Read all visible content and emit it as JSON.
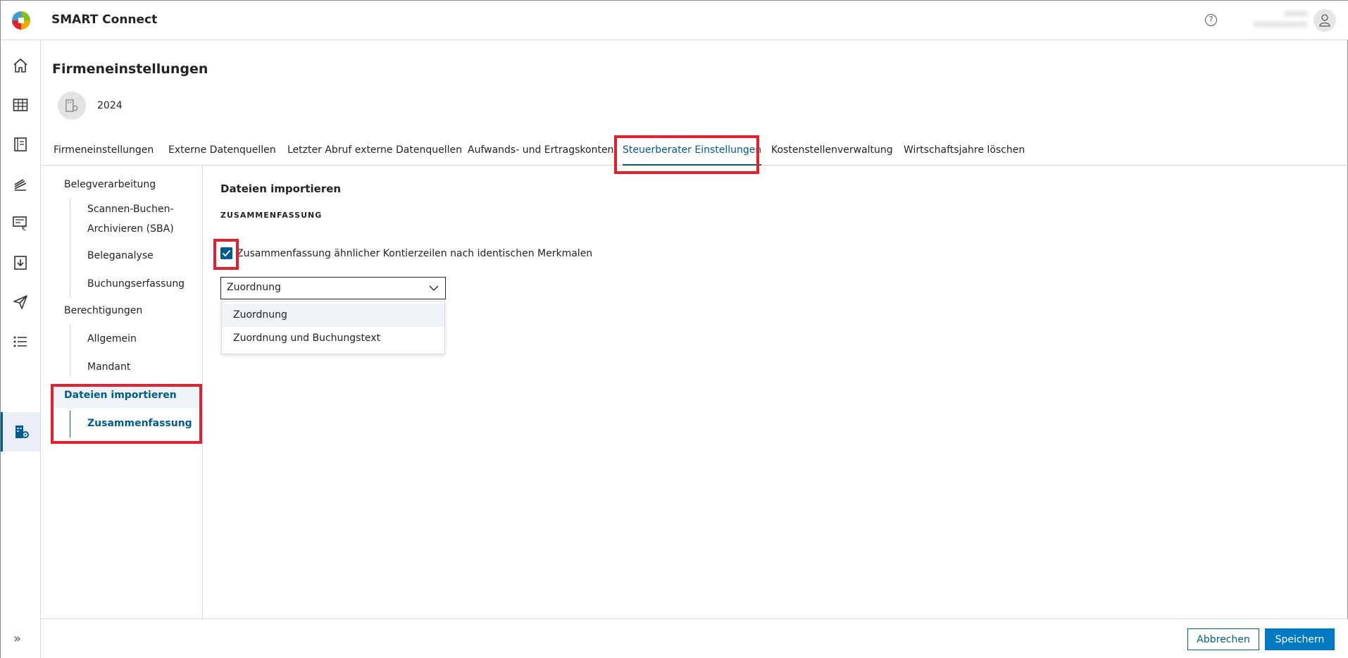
{
  "app": {
    "title": "SMART Connect"
  },
  "header": {
    "help_icon": "?"
  },
  "page": {
    "title": "Firmeneinstellungen",
    "company_year": "2024"
  },
  "tabs": [
    {
      "label": "Firmeneinstellungen"
    },
    {
      "label": "Externe Datenquellen"
    },
    {
      "label": "Letzter Abruf externe Datenquellen"
    },
    {
      "label": "Aufwands- und Ertragskonten"
    },
    {
      "label": "Steuerberater Einstellungen",
      "active": true
    },
    {
      "label": "Kostenstellenverwaltung"
    },
    {
      "label": "Wirtschaftsjahre löschen"
    }
  ],
  "sidenav": {
    "groups": [
      {
        "label": "Belegverarbeitung",
        "items": [
          "Scannen-Buchen-Archivieren (SBA)",
          "Beleganalyse",
          "Buchungserfassung"
        ]
      },
      {
        "label": "Berechtigungen",
        "items": [
          "Allgemein",
          "Mandant"
        ]
      },
      {
        "label": "Dateien importieren",
        "items": [
          "Zusammenfassung"
        ],
        "active": true
      }
    ]
  },
  "content": {
    "section_title": "Dateien importieren",
    "section_subtitle": "ZUSAMMENFASSUNG",
    "checkbox_label": "Zusammenfassung ähnlicher Kontierzeilen nach identischen Merkmalen",
    "checkbox_checked": true,
    "select_value": "Zuordnung",
    "select_options": [
      "Zuordnung",
      "Zuordnung und Buchungstext"
    ]
  },
  "footer": {
    "cancel_label": "Abbrechen",
    "save_label": "Speichern"
  },
  "colors": {
    "accent": "#005b92",
    "primary_button": "#007ac3",
    "highlight": "#e5202e"
  },
  "icons": {
    "rail": [
      "home-icon",
      "table-icon",
      "ledger-icon",
      "stack-icon",
      "invoice-icon",
      "download-icon",
      "send-icon",
      "list-icon",
      "company-settings-icon"
    ],
    "expand": "double-chevron-right-icon"
  }
}
